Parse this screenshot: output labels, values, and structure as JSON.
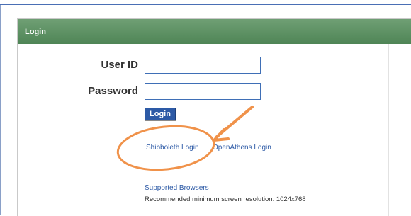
{
  "panel": {
    "title": "Login"
  },
  "form": {
    "user_id_label": "User ID",
    "user_id_value": "",
    "password_label": "Password",
    "password_value": "",
    "login_button": "Login"
  },
  "links": {
    "shibboleth": "Shibboleth Login",
    "openathens": "OpenAthens Login",
    "supported_browsers": "Supported Browsers"
  },
  "footer": {
    "resolution_note": "Recommended minimum screen resolution: 1024x768"
  },
  "colors": {
    "header_green": "#5a8f60",
    "link_blue": "#2d5aa6",
    "annotation_orange": "#f0924a"
  }
}
